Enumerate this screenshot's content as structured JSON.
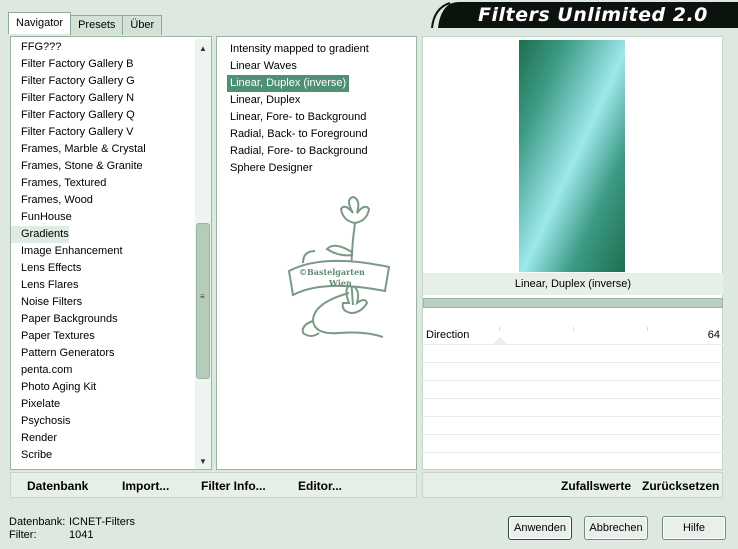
{
  "tabs": [
    "Navigator",
    "Presets",
    "Über"
  ],
  "banner": {
    "title": "Filters Unlimited 2.0"
  },
  "categories": {
    "items": [
      "FFG???",
      "Filter Factory Gallery B",
      "Filter Factory Gallery G",
      "Filter Factory Gallery N",
      "Filter Factory Gallery Q",
      "Filter Factory Gallery V",
      "Frames, Marble & Crystal",
      "Frames, Stone & Granite",
      "Frames, Textured",
      "Frames, Wood",
      "FunHouse",
      "Gradients",
      "Image Enhancement",
      "Lens Effects",
      "Lens Flares",
      "Noise Filters",
      "Paper Backgrounds",
      "Paper Textures",
      "Pattern Generators",
      "penta.com",
      "Photo Aging Kit",
      "Pixelate",
      "Psychosis",
      "Render",
      "Scribe"
    ],
    "selected": "Gradients"
  },
  "filters": {
    "items": [
      "Intensity mapped to gradient",
      "Linear Waves",
      "Linear, Duplex (inverse)",
      "Linear, Duplex",
      "Linear, Fore- to Background",
      "Radial, Back- to Foreground",
      "Radial, Fore- to Background",
      "Sphere Designer"
    ],
    "selected": "Linear, Duplex (inverse)"
  },
  "watermark": {
    "line1": "©Bastelgarten",
    "line2": "Wien"
  },
  "preview": {
    "filter_name": "Linear, Duplex (inverse)"
  },
  "params": [
    {
      "label": "Direction",
      "value": "64"
    }
  ],
  "left_toolbar": {
    "database": "Datenbank",
    "import": "Import...",
    "filter_info": "Filter Info...",
    "editor": "Editor..."
  },
  "right_toolbar": {
    "random": "Zufallswerte",
    "reset": "Zurücksetzen"
  },
  "status": {
    "database_label": "Datenbank:",
    "database_value": "ICNET-Filters",
    "filter_label": "Filter:",
    "filter_value": "1041"
  },
  "buttons": {
    "apply": "Anwenden",
    "cancel": "Abbrechen",
    "help": "Hilfe"
  },
  "colors": {
    "selection": "#4f8f73",
    "background": "#dde9e0",
    "banner": "#0c120e"
  }
}
